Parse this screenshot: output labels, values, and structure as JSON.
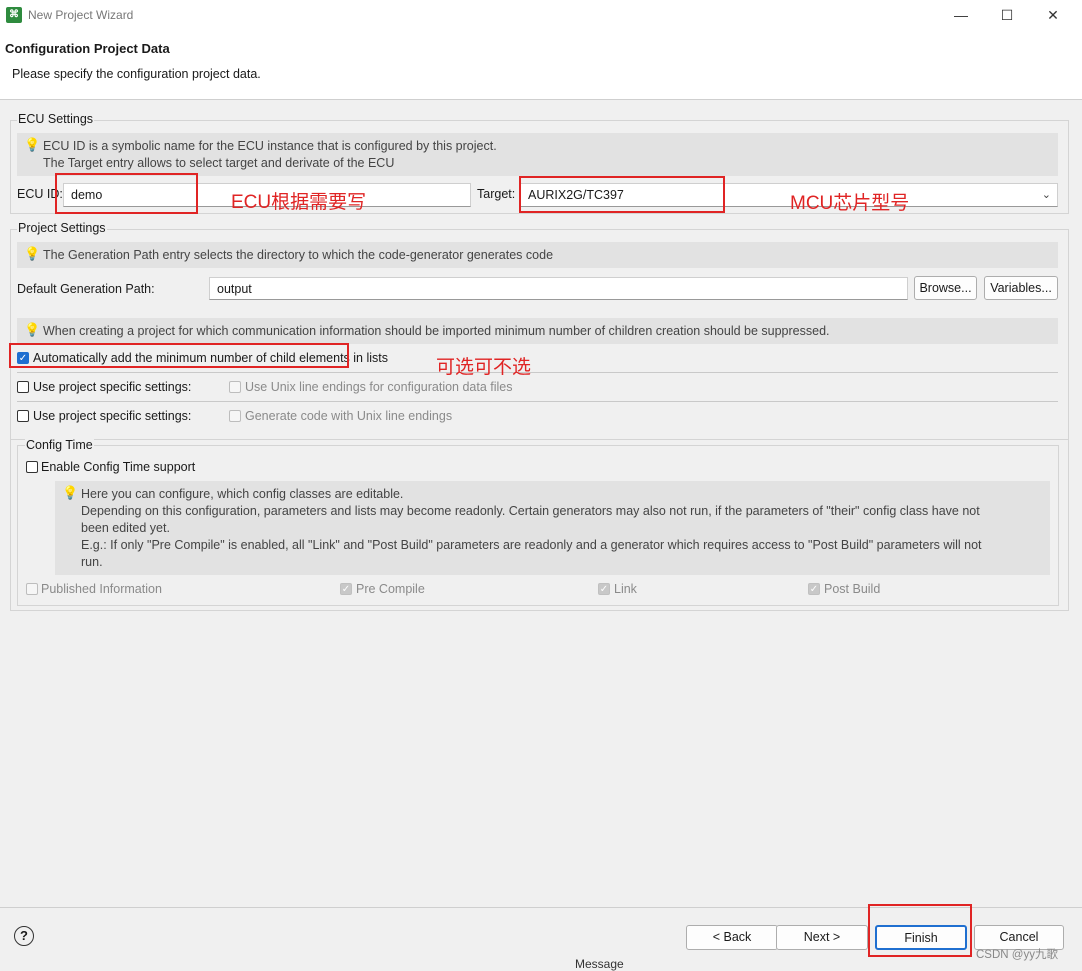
{
  "window": {
    "title": "New Project Wizard",
    "icon_name": "app-logo-icon"
  },
  "header": {
    "title": "Configuration Project Data",
    "description": "Please specify the configuration project data."
  },
  "ecu": {
    "group_label": "ECU Settings",
    "info_line1": "ECU ID is a symbolic name for the ECU instance that is configured by this project.",
    "info_line2": "The Target entry allows to select target and derivate of the ECU",
    "ecu_id_label": "ECU ID:",
    "ecu_id_value": "demo",
    "target_label": "Target:",
    "target_value": "AURIX2G/TC397"
  },
  "project": {
    "group_label": "Project Settings",
    "info": "The Generation Path entry selects the directory to which the code-generator generates code",
    "path_label": "Default Generation Path:",
    "path_value": "output",
    "browse_label": "Browse...",
    "variables_label": "Variables...",
    "info2": "When creating a project for which communication information should be imported minimum number of children creation should be suppressed.",
    "auto_add_label": "Automatically add the minimum number of child elements in lists",
    "auto_add_checked": true,
    "specific1_label": "Use project specific settings:",
    "unix_data_label": "Use Unix line endings for configuration data files",
    "specific2_label": "Use project specific settings:",
    "unix_code_label": "Generate code with Unix line endings"
  },
  "config_time": {
    "group_label": "Config Time",
    "enable_label": "Enable Config Time support",
    "info_line1": "Here you can configure, which config classes are editable.",
    "info_line2": "Depending on this configuration, parameters and lists may become readonly. Certain generators may also not run, if the parameters of \"their\" config class have not",
    "info_line3": "been edited yet.",
    "info_line4": "E.g.: If only \"Pre Compile\" is enabled, all \"Link\" and \"Post Build\" parameters are readonly and a generator which requires access to \"Post Build\" parameters will not",
    "info_line5": "run.",
    "classes": [
      "Published Information",
      "Pre Compile",
      "Link",
      "Post Build"
    ]
  },
  "annotations": {
    "ecu_note": "ECU根据需要写",
    "mcu_note": "MCU芯片型号",
    "optional_note": "可选可不选"
  },
  "footer": {
    "back_label": "< Back",
    "next_label": "Next >",
    "finish_label": "Finish",
    "cancel_label": "Cancel",
    "cut_text": "Message",
    "watermark": "CSDN @yy九歌"
  },
  "colors": {
    "annotation": "#e02424",
    "accent": "#1f6fd0"
  }
}
